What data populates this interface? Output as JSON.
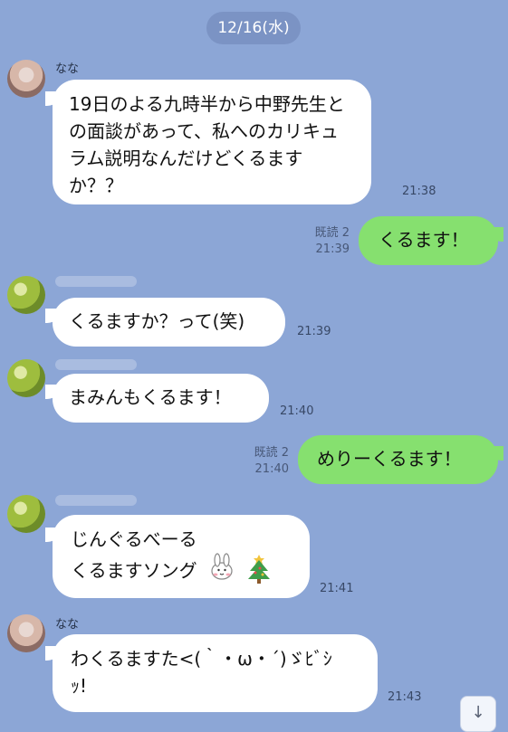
{
  "date": "12/16(水)",
  "messages": [
    {
      "sender": "なな",
      "text": "19日のよる九時半から中野先生との面談があって、私へのカリキュラム説明なんだけどくるますか？？",
      "time": "21:38"
    },
    {
      "sender": "me",
      "text": "くるます！",
      "read": "既読 2",
      "time": "21:39"
    },
    {
      "sender": "",
      "text": "くるますか？って(笑)",
      "time": "21:39"
    },
    {
      "sender": "",
      "text": "まみんもくるます！",
      "time": "21:40"
    },
    {
      "sender": "me",
      "text": "めりーくるます！",
      "read": "既読 2",
      "time": "21:40"
    },
    {
      "sender": "",
      "line1": "じんぐるべーる",
      "line2": "くるますソング",
      "time": "21:41"
    },
    {
      "sender": "なな",
      "line1": "わくるますた<(｀・ω・´)ゞﾋﾞｼ",
      "line2": "ｯ!",
      "time": "21:43"
    }
  ],
  "controls": {
    "scroll_icon": "↓"
  },
  "colors": {
    "background": "#8ca6d6",
    "incoming_bubble": "#ffffff",
    "outgoing_bubble": "#86e06f"
  },
  "icons": {
    "rabbit": "white-rabbit-sticker",
    "tree": "christmas-tree-icon"
  }
}
